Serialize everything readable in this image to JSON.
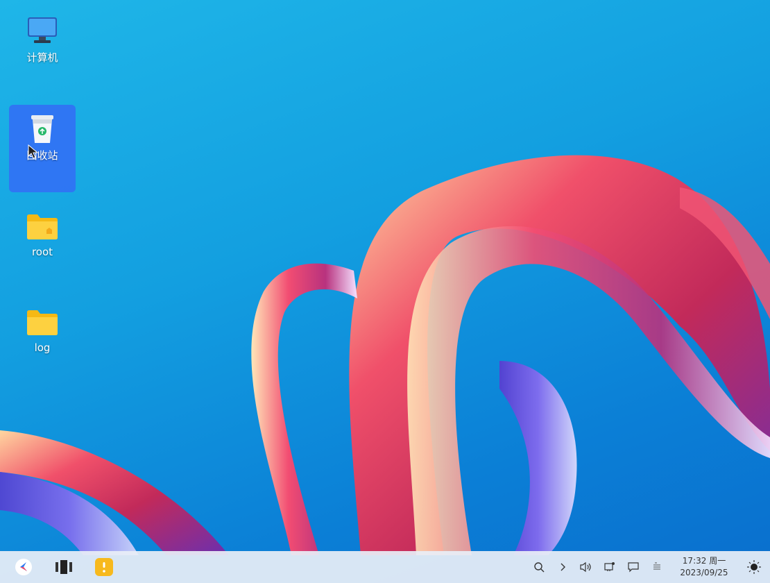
{
  "desktop": {
    "icons": [
      {
        "label": "计算机",
        "icon": "computer-icon"
      },
      {
        "label": "回收站",
        "icon": "trash-icon",
        "selected": true
      },
      {
        "label": "root",
        "icon": "home-folder-icon"
      },
      {
        "label": "log",
        "icon": "folder-icon"
      }
    ]
  },
  "taskbar": {
    "start_icon": "kylin-start-icon",
    "task_view_icon": "task-view-icon",
    "app_icon": "yellow-app-icon",
    "tray": {
      "icons": [
        "search-icon",
        "chevron-right-icon",
        "volume-icon",
        "network-icon",
        "notification-icon",
        "keyboard-icon"
      ],
      "time": "17:32 周一",
      "date": "2023/09/25",
      "theme_icon": "night-mode-icon"
    }
  },
  "colors": {
    "desktop_bg": "#139fe0",
    "selection": "#326ef5",
    "folder": "#f7c31d"
  }
}
